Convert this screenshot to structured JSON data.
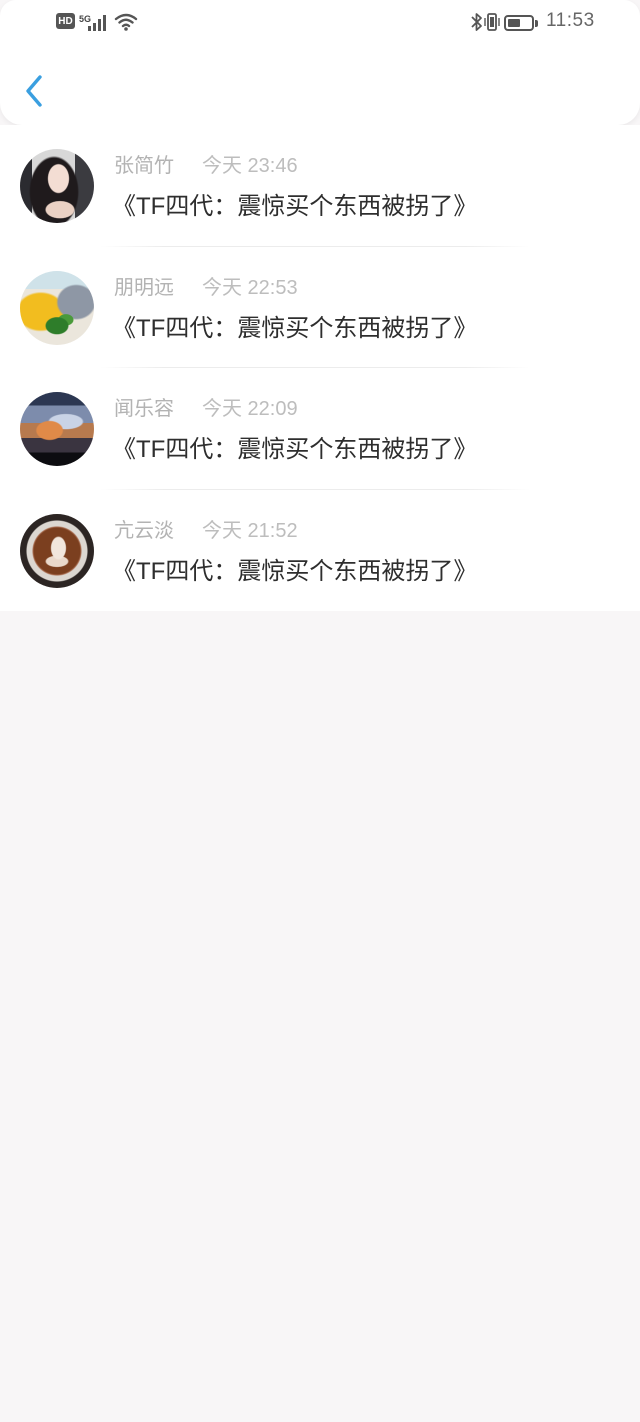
{
  "status_bar": {
    "network_badge": "HD",
    "network_type": "5G",
    "time": "11:53",
    "battery_level": 0.55,
    "icons": [
      "hd-icon",
      "signal-icon",
      "wifi-icon",
      "bluetooth-icon",
      "vibrate-icon",
      "battery-icon"
    ]
  },
  "header": {
    "back_icon": "chevron-left-icon"
  },
  "colors": {
    "accent": "#3a9fe0",
    "page_background": "#f8f6f7",
    "secondary_text": "#b3b3b3",
    "primary_text": "#2e2e2e"
  },
  "messages": [
    {
      "name": "张简竹",
      "time": "今天 23:46",
      "text": "《TF四代：震惊买个东西被拐了》",
      "avatar": "avatar-woman-photo"
    },
    {
      "name": "朋明远",
      "time": "今天 22:53",
      "text": "《TF四代：震惊买个东西被拐了》",
      "avatar": "avatar-corn-photo"
    },
    {
      "name": "闻乐容",
      "time": "今天 22:09",
      "text": "《TF四代：震惊买个东西被拐了》",
      "avatar": "avatar-game-art"
    },
    {
      "name": "亢云淡",
      "time": "今天 21:52",
      "text": "《TF四代：震惊买个东西被拐了》",
      "avatar": "avatar-latte-art"
    }
  ]
}
